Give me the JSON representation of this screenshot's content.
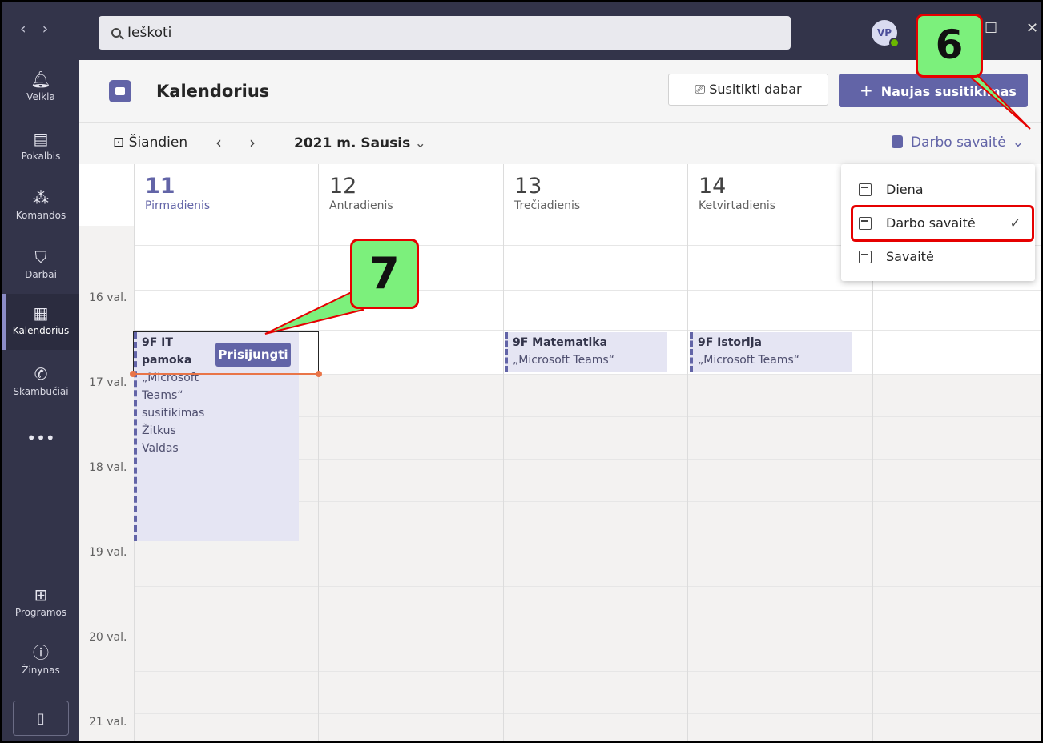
{
  "titlebar": {
    "search_placeholder": "Ieškoti",
    "avatar_initials": "VP"
  },
  "rail": {
    "items": [
      {
        "label": "Veikla",
        "icon": "bell-icon"
      },
      {
        "label": "Pokalbis",
        "icon": "chat-icon"
      },
      {
        "label": "Komandos",
        "icon": "teams-icon"
      },
      {
        "label": "Darbai",
        "icon": "backpack-icon"
      },
      {
        "label": "Kalendorius",
        "icon": "calendar-icon"
      },
      {
        "label": "Skambučiai",
        "icon": "phone-icon"
      },
      {
        "label": "•••",
        "icon": "more-icon"
      },
      {
        "label": "Programos",
        "icon": "apps-icon"
      },
      {
        "label": "Žinynas",
        "icon": "help-icon"
      }
    ]
  },
  "header": {
    "title": "Kalendorius",
    "meet_now": "Susitikti dabar",
    "new_meeting": "Naujas susitikimas"
  },
  "toolbar": {
    "today": "Šiandien",
    "month": "2021 m. Sausis",
    "view": "Darbo savaitė"
  },
  "days": [
    {
      "num": "11",
      "name": "Pirmadienis"
    },
    {
      "num": "12",
      "name": "Antradienis"
    },
    {
      "num": "13",
      "name": "Trečiadienis"
    },
    {
      "num": "14",
      "name": "Ketvirtadienis"
    }
  ],
  "hours": [
    "16 val.",
    "17 val.",
    "18 val.",
    "19 val.",
    "20 val.",
    "21 val."
  ],
  "events": {
    "mon": {
      "title_line1": "9F IT",
      "title_line2": "pamoka",
      "lines": [
        "„Microsoft",
        "Teams“",
        "susitikimas",
        "Žitkus",
        "Valdas"
      ],
      "join": "Prisijungti"
    },
    "wed": {
      "title": "9F Matematika",
      "sub": "„Microsoft Teams“ susitikim"
    },
    "thu": {
      "title": "9F Istorija",
      "sub": "„Microsoft Teams“ susitikim"
    }
  },
  "view_menu": [
    {
      "label": "Diena",
      "icon": "day-icon"
    },
    {
      "label": "Darbo savaitė",
      "icon": "workweek-icon",
      "checked": true
    },
    {
      "label": "Savaitė",
      "icon": "week-icon"
    }
  ],
  "callouts": {
    "six": "6",
    "seven": "7"
  },
  "colors": {
    "accent": "#6264a7",
    "rail": "#33344a",
    "callout_fill": "#7cf07c",
    "callout_border": "#e60000",
    "timebar": "#e97548"
  }
}
